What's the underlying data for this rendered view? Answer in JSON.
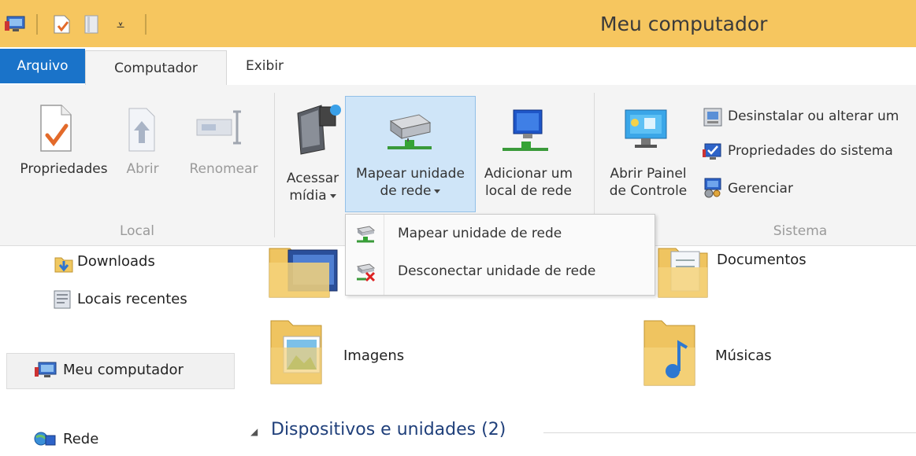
{
  "window": {
    "title": "Meu computador"
  },
  "tabs": [
    {
      "label": "Arquivo"
    },
    {
      "label": "Computador"
    },
    {
      "label": "Exibir"
    }
  ],
  "ribbon": {
    "groups": [
      {
        "label": "Local"
      },
      {
        "label": "Sistema"
      }
    ],
    "local": {
      "propriedades": "Propriedades",
      "abrir": "Abrir",
      "renomear": "Renomear"
    },
    "network": {
      "acessar_line1": "Acessar",
      "acessar_line2": "mídia",
      "mapear_line1": "Mapear unidade",
      "mapear_line2": "de rede",
      "adicionar_line1": "Adicionar um",
      "adicionar_line2": "local de rede"
    },
    "sistema": {
      "painel_line1": "Abrir Painel",
      "painel_line2": "de Controle",
      "desinstalar": "Desinstalar ou alterar um",
      "propriedades_sistema": "Propriedades do sistema",
      "gerenciar": "Gerenciar"
    }
  },
  "dropdown": {
    "items": [
      {
        "label": "Mapear unidade de rede"
      },
      {
        "label": "Desconectar unidade de rede"
      }
    ]
  },
  "sidebar": {
    "items": [
      {
        "label": "Downloads"
      },
      {
        "label": "Locais recentes"
      },
      {
        "label": "Meu computador"
      },
      {
        "label": "Rede"
      }
    ]
  },
  "content": {
    "folders": [
      {
        "label": "Documentos"
      },
      {
        "label": "Imagens"
      },
      {
        "label": "Músicas"
      }
    ],
    "section_header": "Dispositivos e unidades (2)"
  },
  "colors": {
    "title_bar": "#f6c65f",
    "arquivo_tab": "#1a73c9",
    "selected_button": "#cfe5f8",
    "section_header": "#1f3f7a"
  }
}
